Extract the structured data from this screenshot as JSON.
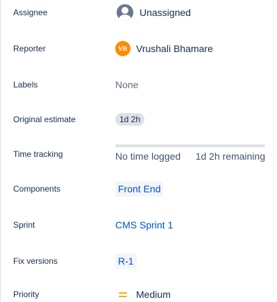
{
  "fields": {
    "assignee": {
      "label": "Assignee",
      "value": "Unassigned",
      "icon": "unassigned-avatar-icon"
    },
    "reporter": {
      "label": "Reporter",
      "avatar_initials": "VB",
      "value": "Vrushali Bhamare",
      "avatar_color": "#ff8b00"
    },
    "labels": {
      "label": "Labels",
      "value": "None"
    },
    "original_estimate": {
      "label": "Original estimate",
      "value": "1d 2h"
    },
    "time_tracking": {
      "label": "Time tracking",
      "logged": "No time logged",
      "remaining": "1d 2h remaining",
      "progress_fraction": 0
    },
    "components": {
      "label": "Components",
      "value": "Front End"
    },
    "sprint": {
      "label": "Sprint",
      "value": "CMS Sprint 1"
    },
    "fix_versions": {
      "label": "Fix versions",
      "value": "R-1"
    },
    "priority": {
      "label": "Priority",
      "value": "Medium",
      "icon": "priority-medium-icon",
      "icon_color": "#ffab00"
    }
  },
  "colors": {
    "link": "#0052cc",
    "text": "#172b4d",
    "muted": "#42526e",
    "lozenge_bg": "#dfe1e6"
  }
}
